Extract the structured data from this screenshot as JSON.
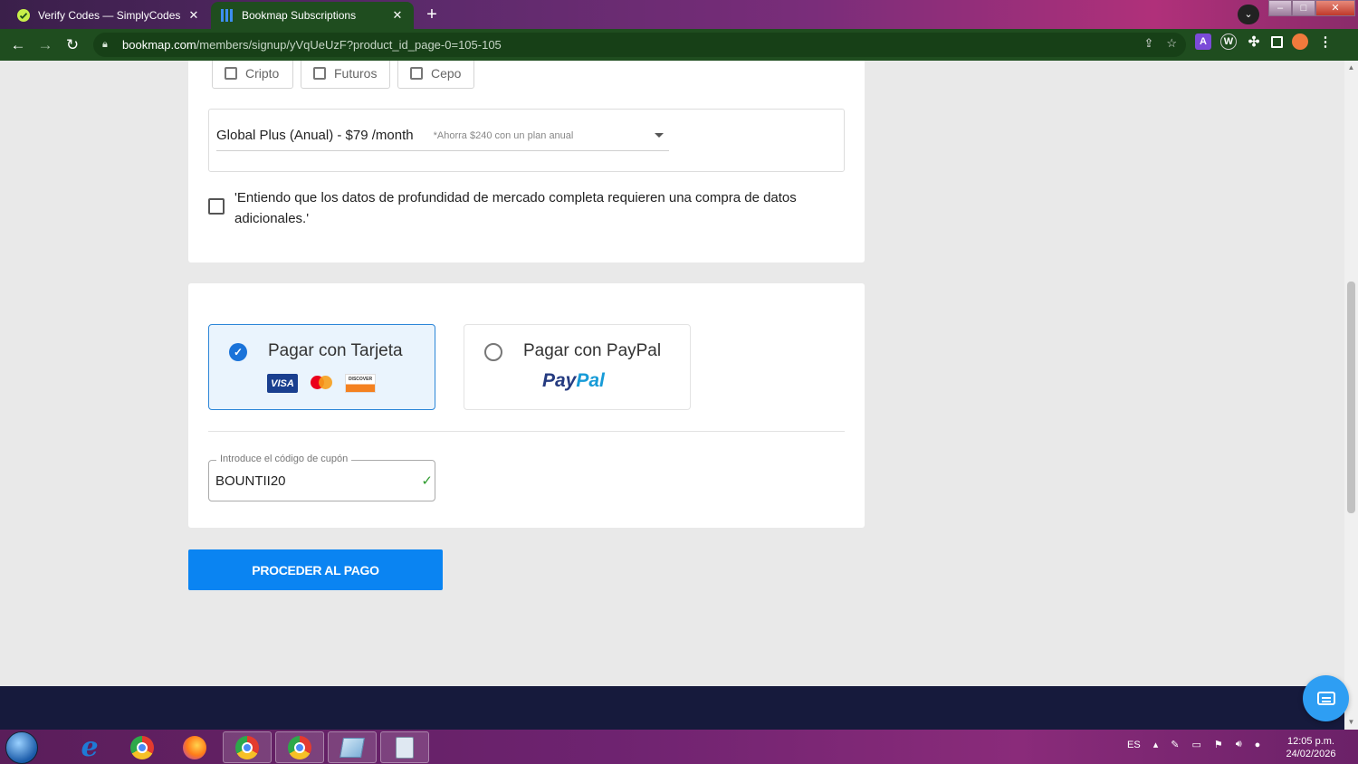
{
  "browser": {
    "tabs": [
      {
        "title": "Verify Codes — SimplyCodes",
        "active": false,
        "icon": "simplycodes-icon"
      },
      {
        "title": "Bookmap Subscriptions",
        "active": true,
        "icon": "bookmap-icon"
      }
    ],
    "url_domain": "bookmap.com",
    "url_path": "/members/signup/yVqUeUzF?product_id_page-0=105-105"
  },
  "page": {
    "market_options": [
      "Cripto",
      "Futuros",
      "Cepo"
    ],
    "plan": {
      "selected": "Global Plus (Anual) - $79 /month",
      "hint": "*Ahorra $240 con un plan anual"
    },
    "agreement_text": "'Entiendo que los datos de profundidad de mercado completa requieren una compra de datos adicionales.'",
    "payment": {
      "card_label": "Pagar con Tarjeta",
      "paypal_label": "Pagar con PayPal",
      "paypal_logo_part1": "Pay",
      "paypal_logo_part2": "Pal",
      "visa_text": "VISA",
      "discover_text": "DISCOVER",
      "selected": "card"
    },
    "coupon": {
      "legend": "Introduce el código de cupón",
      "value": "BOUNTII20"
    },
    "cta_label": "PROCEDER AL PAGO"
  },
  "taskbar": {
    "language": "ES",
    "time": "12:05 p.m.",
    "date": "24/02/2026"
  },
  "colors": {
    "accent": "#0a84f2",
    "selected_border": "#2c86d8",
    "footer": "#161a3c",
    "toolbar": "#1f4d1f"
  }
}
